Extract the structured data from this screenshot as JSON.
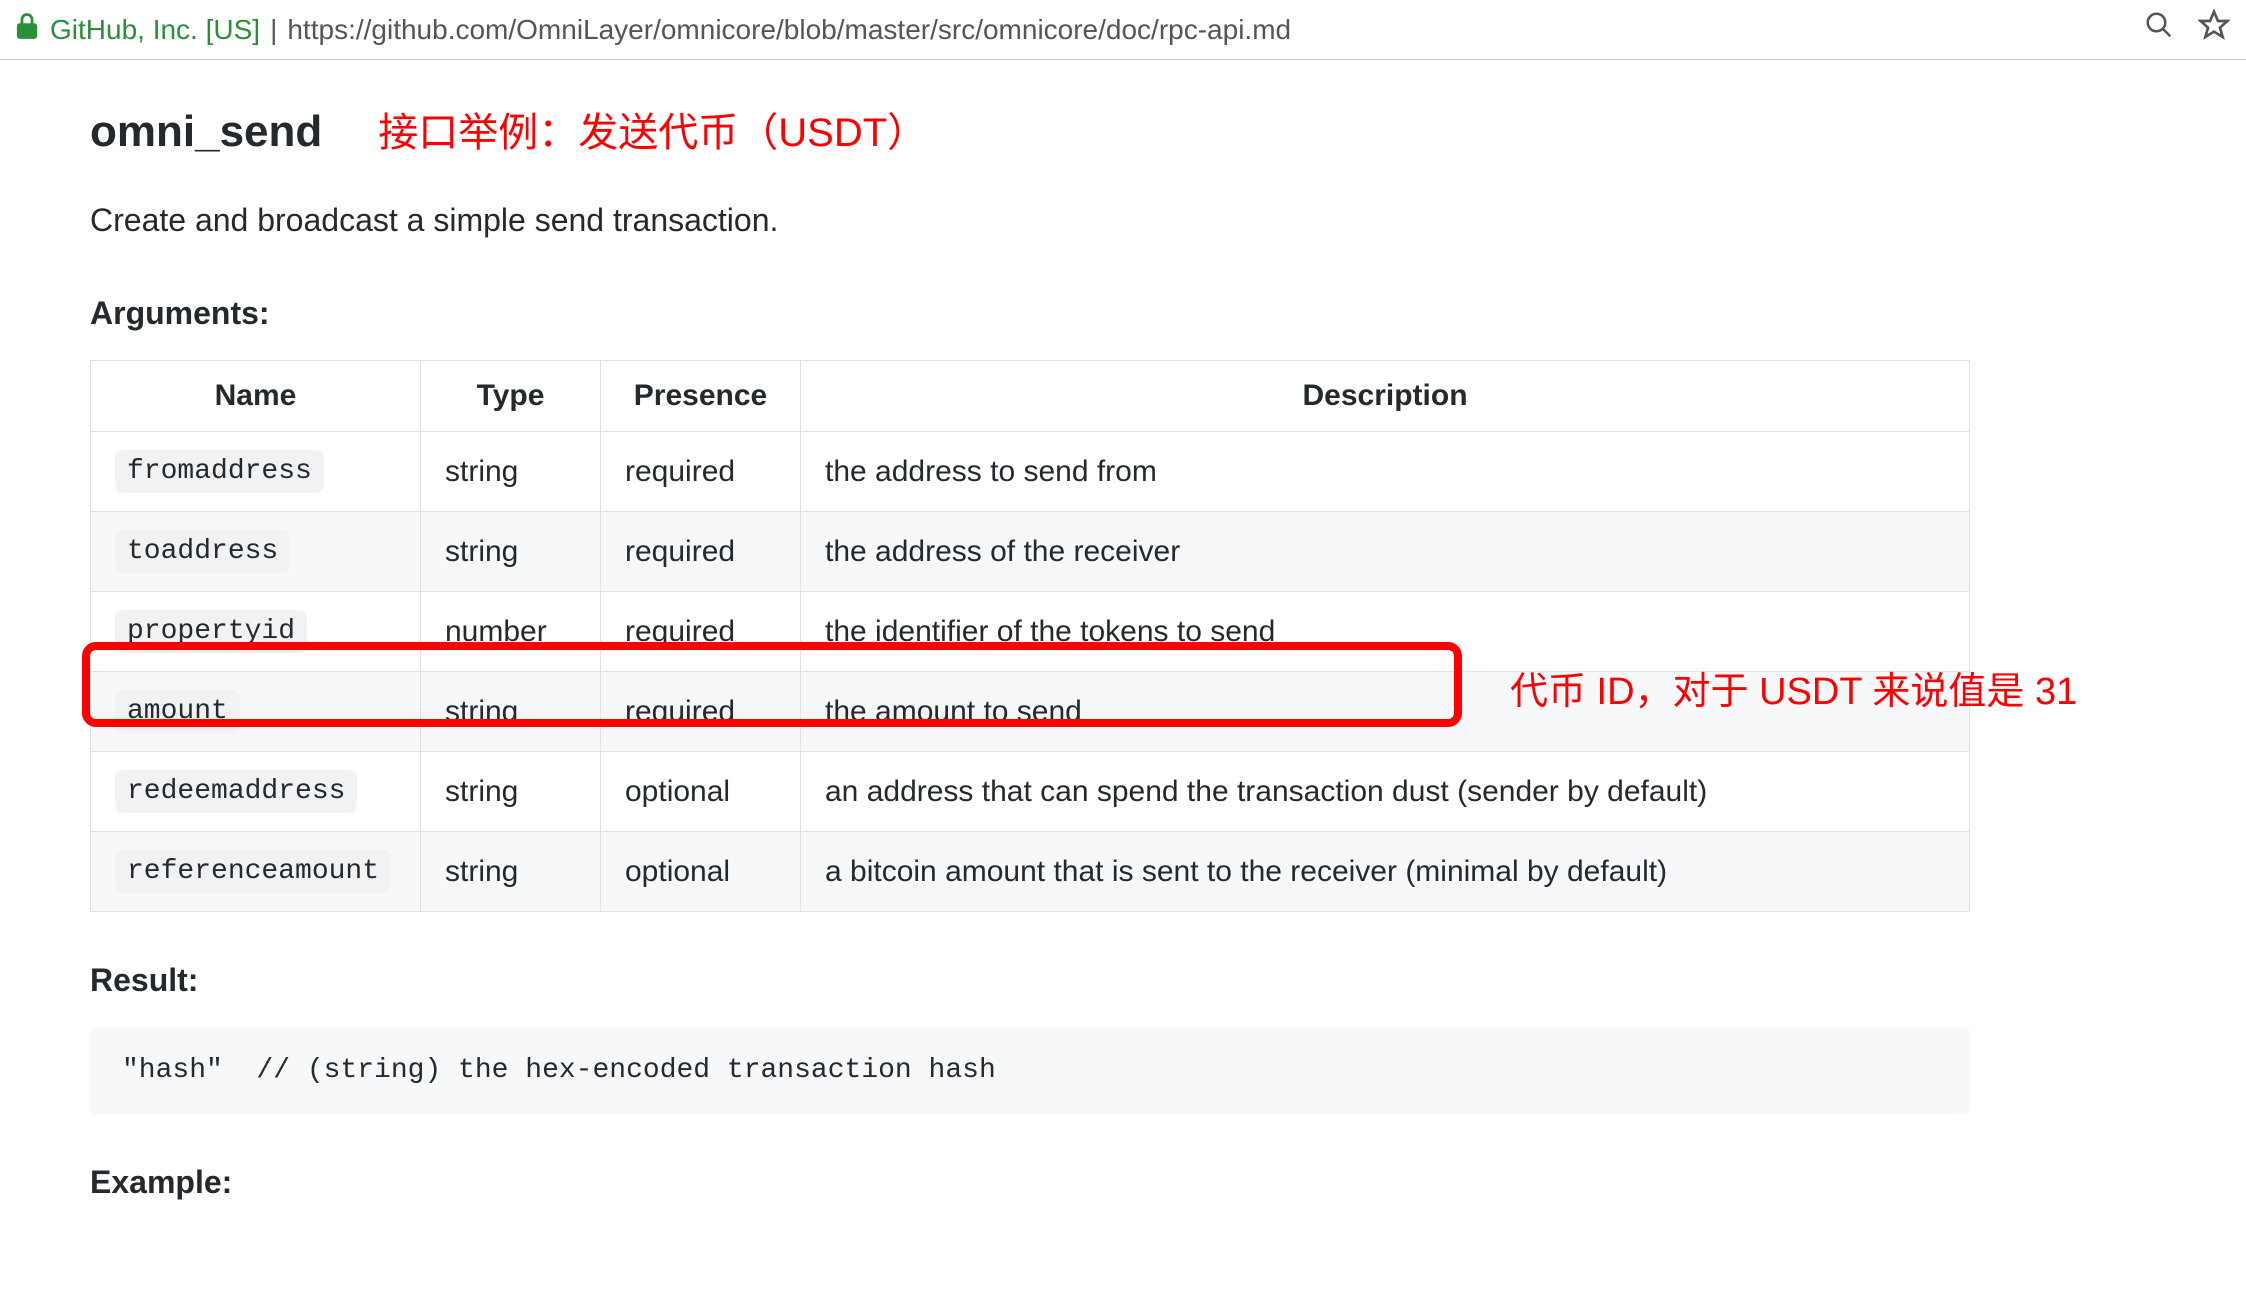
{
  "urlbar": {
    "org": "GitHub, Inc. [US]",
    "url": "https://github.com/OmniLayer/omnicore/blob/master/src/omnicore/doc/rpc-api.md"
  },
  "page": {
    "heading": "omni_send",
    "heading_annotation": "接口举例：发送代币（USDT）",
    "description": "Create and broadcast a simple send transaction.",
    "arguments_label": "Arguments:",
    "result_label": "Result:",
    "example_label": "Example:",
    "result_code": "\"hash\"  // (string) the hex-encoded transaction hash",
    "row_annotation": "代币 ID，对于 USDT 来说值是 31"
  },
  "table": {
    "headers": {
      "name": "Name",
      "type": "Type",
      "presence": "Presence",
      "description": "Description"
    },
    "rows": [
      {
        "name": "fromaddress",
        "type": "string",
        "presence": "required",
        "description": "the address to send from"
      },
      {
        "name": "toaddress",
        "type": "string",
        "presence": "required",
        "description": "the address of the receiver"
      },
      {
        "name": "propertyid",
        "type": "number",
        "presence": "required",
        "description": "the identifier of the tokens to send"
      },
      {
        "name": "amount",
        "type": "string",
        "presence": "required",
        "description": "the amount to send"
      },
      {
        "name": "redeemaddress",
        "type": "string",
        "presence": "optional",
        "description": "an address that can spend the transaction dust (sender by default)"
      },
      {
        "name": "referenceamount",
        "type": "string",
        "presence": "optional",
        "description": "a bitcoin amount that is sent to the receiver (minimal by default)"
      }
    ]
  }
}
